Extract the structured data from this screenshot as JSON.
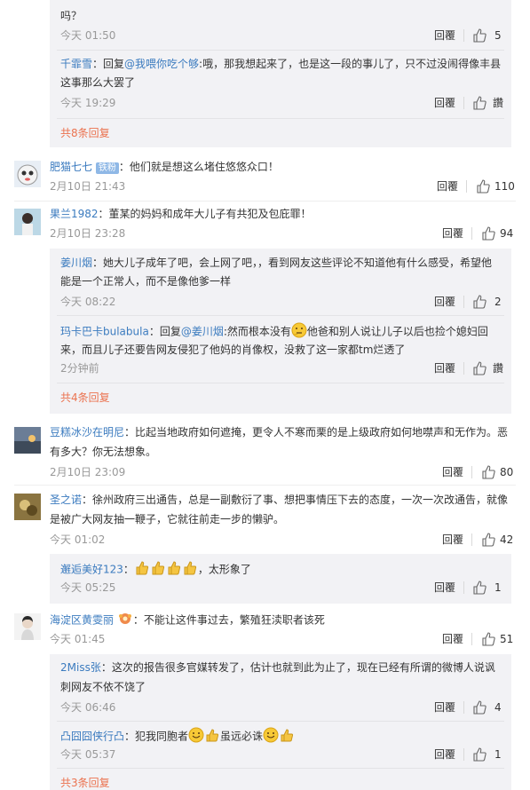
{
  "actions": {
    "reply": "回覆",
    "zan": "讚"
  },
  "top_thread": {
    "tail_text": "吗？",
    "tail_time": "今天 01:50",
    "tail_likes": "5",
    "sub_user": "千霏雪",
    "sub_prefix": "：回复",
    "sub_mention": "@我喂你吃个够",
    "sub_text_1": ":哦，那我想起来了，也是这一段的事儿了，只不过没闹得像丰县",
    "sub_text_2": "这事那么大罢了",
    "sub_time": "今天 19:29",
    "more": "共8条回复"
  },
  "c1": {
    "user": "肥猫七七",
    "badge": "铁粉",
    "text": "：他们就是想这么堵住悠悠众口！",
    "time": "2月10日 21:43",
    "likes": "110"
  },
  "c2": {
    "user": "果兰1982",
    "text": "：董某的妈妈和成年大儿子有共犯及包庇罪！",
    "time": "2月10日 23:28",
    "likes": "94",
    "r1_user": "姜川烟",
    "r1_text_1": "：她大儿子成年了吧，会上网了吧，，看到网友这些评论不知道他有什么感受，希望他",
    "r1_text_2": "能是一个正常人，而不是像他爹一样",
    "r1_time": "今天 08:22",
    "r1_likes": "2",
    "r2_user": "玛卡巴卡bulabula",
    "r2_prefix": "：回复",
    "r2_mention": "@姜川烟",
    "r2_text_a": ":然而根本没有",
    "r2_text_b": "他爸和别人说让儿子以后也捡个媳妇回",
    "r2_text_2": "来，而且儿子还要告网友侵犯了他妈的肖像权，没救了这一家都tm烂透了",
    "r2_time": "2分钟前",
    "more": "共4条回复"
  },
  "c3": {
    "user": "豆糕冰沙在明尼",
    "text_1": "：比起当地政府如何遮掩，更令人不寒而栗的是上级政府如何地噤声和无作为。恶",
    "text_2": "有多大？你无法想象。",
    "time": "2月10日 23:09",
    "likes": "80"
  },
  "c4": {
    "user": "圣之诺",
    "text_1": "：徐州政府三出通告，总是一副敷衍了事、想把事情压下去的态度，一次一次改通告，就像",
    "text_2": "是被广大网友抽一鞭子，它就往前走一步的懒驴。",
    "time": "今天 01:02",
    "likes": "42",
    "r1_user": "邂逅美好123",
    "r1_text_a": "：",
    "r1_text_b": "，太形象了",
    "r1_time": "今天 05:25",
    "r1_likes": "1"
  },
  "c5": {
    "user": "海淀区黄雯丽",
    "text": "：不能让这件事过去，繁殖狂渎职者该死",
    "time": "今天 01:45",
    "likes": "51",
    "r1_user": "2Miss张",
    "r1_text_1": "：这次的报告很多官媒转发了，估计也就到此为止了，现在已经有所谓的微博人说讽",
    "r1_text_2": "刺网友不依不饶了",
    "r1_time": "今天 06:46",
    "r1_likes": "4",
    "r2_user": "凸囧囧侠行凸",
    "r2_text_a": "：犯我同胞者",
    "r2_text_b": "虽远必诛",
    "r2_time": "今天 05:37",
    "r2_likes": "1",
    "more": "共3条回复"
  }
}
